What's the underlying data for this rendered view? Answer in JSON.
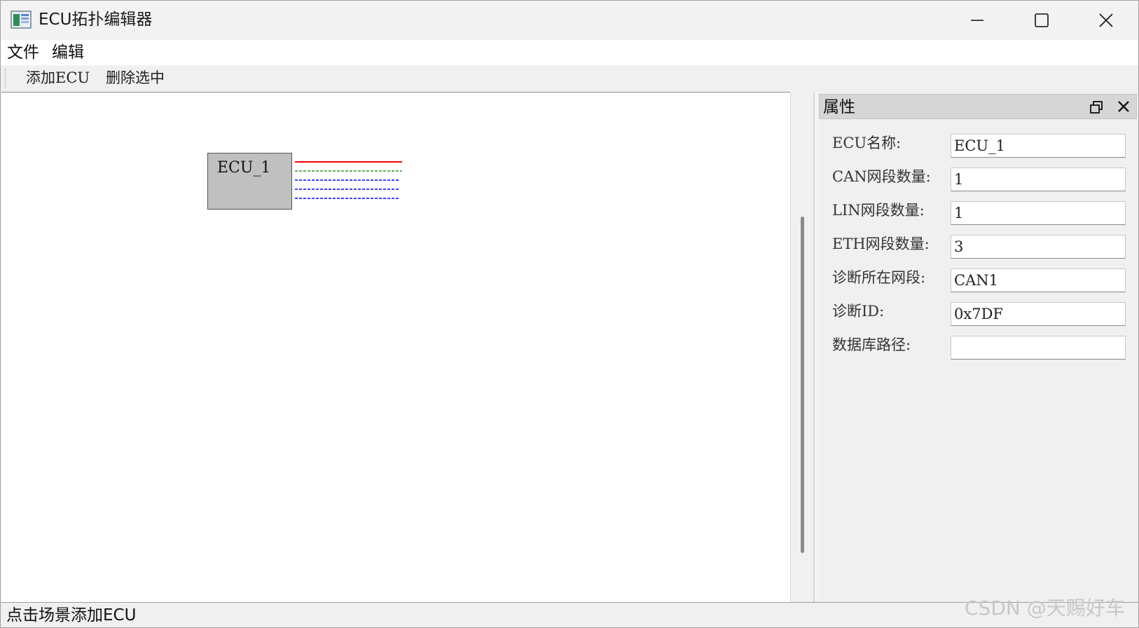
{
  "window": {
    "title": "ECU拓扑编辑器"
  },
  "menu": {
    "items": [
      {
        "label": "文件"
      },
      {
        "label": "编辑"
      }
    ]
  },
  "toolbar": {
    "add_ecu_label": "添加ECU",
    "delete_selected_label": "删除选中"
  },
  "canvas": {
    "node": {
      "label": "ECU_1",
      "fill_color": "#c0c0c0",
      "segment_colors": {
        "can": "#ff0000",
        "lin": "#008000",
        "eth": "#0000ff"
      }
    }
  },
  "properties": {
    "title": "属性",
    "fields": [
      {
        "label": "ECU名称:",
        "value": "ECU_1"
      },
      {
        "label": "CAN网段数量:",
        "value": "1"
      },
      {
        "label": "LIN网段数量:",
        "value": "1"
      },
      {
        "label": "ETH网段数量:",
        "value": "3"
      },
      {
        "label": "诊断所在网段:",
        "value": "CAN1"
      },
      {
        "label": "诊断ID:",
        "value": "0x7DF"
      },
      {
        "label": "数据库路径:",
        "value": ""
      }
    ]
  },
  "status": {
    "text": "点击场景添加ECU"
  },
  "watermark": {
    "text": "CSDN @天赐好车"
  }
}
